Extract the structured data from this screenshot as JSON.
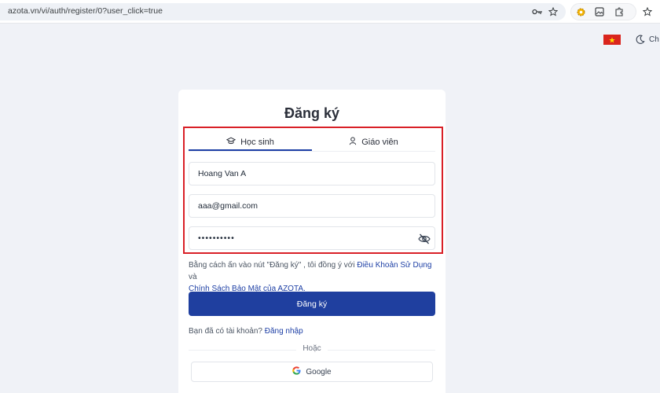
{
  "browser": {
    "url": "azota.vn/vi/auth/register/0?user_click=true",
    "icons": [
      "key-icon",
      "star-icon",
      "extension-gear-icon",
      "image-icon",
      "puzzle-icon",
      "bookmark-star-icon"
    ]
  },
  "header": {
    "language_flag": "vietnam-flag-icon",
    "theme_icon": "moon-icon",
    "theme_text": "Ch"
  },
  "register": {
    "title": "Đăng ký",
    "tabs": [
      {
        "label": "Học sinh",
        "icon": "graduation-cap-icon",
        "active": true
      },
      {
        "label": "Giáo viên",
        "icon": "user-icon",
        "active": false
      }
    ],
    "name_value": "Hoang Van A",
    "email_value": "aaa@gmail.com",
    "password_value": "••••••••••",
    "terms_prefix": "Bằng cách ấn vào nút \"Đăng ký\" , tôi đồng ý với",
    "terms_link": "Điều Khoản Sử Dụng",
    "terms_and": "và",
    "privacy_link": "Chính Sách Bảo Mật của AZOTA.",
    "submit_label": "Đăng ký",
    "have_account_text": "Bạn đã có tài khoản?",
    "login_link": "Đăng nhập",
    "or_text": "Hoặc",
    "google_label": "Google"
  },
  "colors": {
    "primary": "#1f3f9f",
    "highlight_border": "#d92027",
    "page_bg": "#f0f2f7"
  }
}
